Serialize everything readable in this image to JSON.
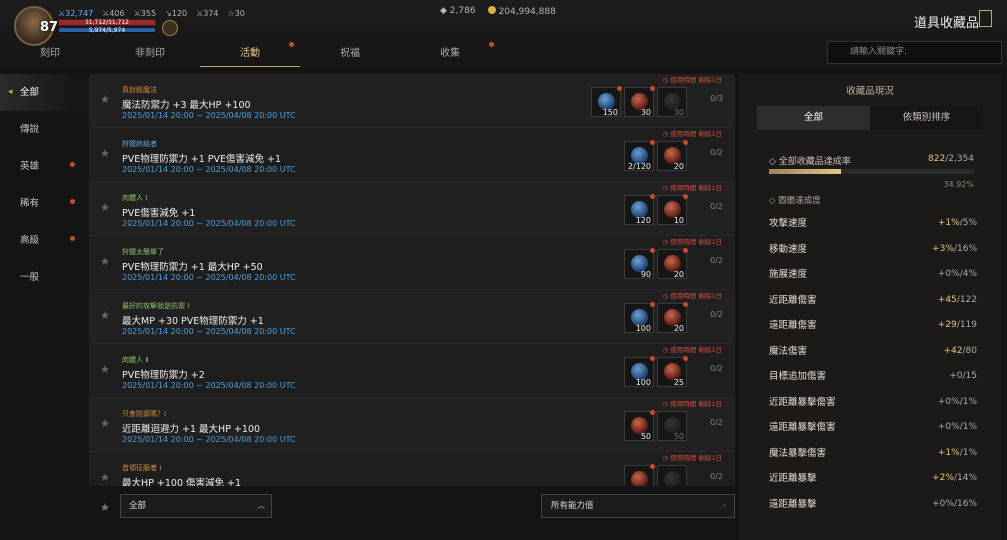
{
  "player": {
    "level": "87",
    "stats": [
      "32,747",
      "406",
      "355",
      "120",
      "374",
      "30"
    ],
    "hp": "31,712/31,712",
    "mp": "5,974/5,974"
  },
  "currency": {
    "diamonds": "2,786",
    "gold": "204,994,888"
  },
  "title": "道具收藏品",
  "tabs": [
    {
      "label": "刻印",
      "dot": false
    },
    {
      "label": "非刻印",
      "dot": false
    },
    {
      "label": "活動",
      "dot": true,
      "active": true
    },
    {
      "label": "祝福",
      "dot": false
    },
    {
      "label": "收集",
      "dot": true
    }
  ],
  "search": {
    "placeholder": "請輸入關鍵字."
  },
  "sidebar": [
    {
      "label": "全部",
      "active": true,
      "dot": false
    },
    {
      "label": "傳說",
      "dot": false
    },
    {
      "label": "英雄",
      "dot": true
    },
    {
      "label": "稀有",
      "dot": true
    },
    {
      "label": "高級",
      "dot": true
    },
    {
      "label": "一般",
      "dot": false
    }
  ],
  "timer_text": "使用時間 剩餘1日",
  "date_range": "2025/01/14 20:00 ~ 2025/04/08 20:00 UTC",
  "rows": [
    {
      "title": "真封殺魔法",
      "title_color": "#d4893a",
      "name": "魔法防禦力 +3 最大HP +100",
      "items": [
        {
          "c": "blue",
          "n": "150",
          "dot": true
        },
        {
          "c": "red",
          "n": "30",
          "dot": true
        },
        {
          "c": "dim",
          "n": "30",
          "dot": false
        }
      ],
      "progress": "0/3"
    },
    {
      "title": "狩獵終結者",
      "title_color": "#5fa8e0",
      "name": "PVE物理防禦力 +1 PVE傷害減免 +1",
      "items": [
        {
          "c": "blue",
          "n": "2/120",
          "dot": true
        },
        {
          "c": "red",
          "n": "20",
          "dot": true
        }
      ],
      "progress": "0/2"
    },
    {
      "title": "肉體人 Ⅰ",
      "title_color": "#8fc06a",
      "name": "PVE傷害減免 +1",
      "items": [
        {
          "c": "blue",
          "n": "120",
          "dot": true
        },
        {
          "c": "red",
          "n": "10",
          "dot": true
        }
      ],
      "progress": "0/2"
    },
    {
      "title": "狩獵太簡單了",
      "title_color": "#8fc06a",
      "name": "PVE物理防禦力 +1 最大HP +50",
      "items": [
        {
          "c": "blue",
          "n": "90",
          "dot": true
        },
        {
          "c": "red",
          "n": "20",
          "dot": true
        }
      ],
      "progress": "0/2"
    },
    {
      "title": "最好的攻擊就是防禦 Ⅰ",
      "title_color": "#8fc06a",
      "name": "最大MP +30 PVE物理防禦力 +1",
      "items": [
        {
          "c": "blue",
          "n": "100",
          "dot": true
        },
        {
          "c": "red",
          "n": "20",
          "dot": true
        }
      ],
      "progress": "0/2"
    },
    {
      "title": "肉體人 Ⅱ",
      "title_color": "#8fc06a",
      "name": "PVE物理防禦力 +2",
      "items": [
        {
          "c": "blue",
          "n": "100",
          "dot": true
        },
        {
          "c": "red",
          "n": "25",
          "dot": true
        }
      ],
      "progress": "0/2"
    },
    {
      "title": "只會防禦嗎？Ⅰ",
      "title_color": "#d4893a",
      "name": "近距離迴避力 +1 最大HP +100",
      "items": [
        {
          "c": "red",
          "n": "50",
          "dot": true
        },
        {
          "c": "dim",
          "n": "50",
          "dot": false
        }
      ],
      "progress": "0/2"
    },
    {
      "title": "首領征服者 Ⅰ",
      "title_color": "#d4893a",
      "name": "最大HP +100 傷害減免 +1",
      "items": [
        {
          "c": "red",
          "n": "",
          "dot": true
        },
        {
          "c": "dim",
          "n": "",
          "dot": false
        }
      ],
      "progress": "0/2"
    }
  ],
  "footer": {
    "filter": "全部",
    "filter2": "所有能力值"
  },
  "panel": {
    "title": "收藏品現況",
    "tabs": [
      "全部",
      "依類別排序"
    ],
    "completion_label": "全部收藏品達成率",
    "completion_value": "822",
    "completion_total": "/2,354",
    "completion_fraction": 0.3492,
    "completion_pct": "34.92%",
    "bonus_label": "圖鑑達成度",
    "stats": [
      {
        "name": "攻擊速度",
        "cur": "+1%",
        "max": "/5%",
        "zero": false
      },
      {
        "name": "移動速度",
        "cur": "+3%",
        "max": "/16%",
        "zero": false
      },
      {
        "name": "施展速度",
        "cur": "+0%",
        "max": "/4%",
        "zero": true
      },
      {
        "name": "近距離傷害",
        "cur": "+45",
        "max": "/122",
        "zero": false
      },
      {
        "name": "遠距離傷害",
        "cur": "+29",
        "max": "/119",
        "zero": false
      },
      {
        "name": "魔法傷害",
        "cur": "+42",
        "max": "/80",
        "zero": false
      },
      {
        "name": "目標追加傷害",
        "cur": "+0",
        "max": "/15",
        "zero": true
      },
      {
        "name": "近距離暴擊傷害",
        "cur": "+0%",
        "max": "/1%",
        "zero": true
      },
      {
        "name": "遠距離暴擊傷害",
        "cur": "+0%",
        "max": "/1%",
        "zero": true
      },
      {
        "name": "魔法暴擊傷害",
        "cur": "+1%",
        "max": "/1%",
        "zero": false
      },
      {
        "name": "近距離暴擊",
        "cur": "+2%",
        "max": "/14%",
        "zero": false
      },
      {
        "name": "遠距離暴擊",
        "cur": "+0%",
        "max": "/16%",
        "zero": true
      }
    ]
  }
}
